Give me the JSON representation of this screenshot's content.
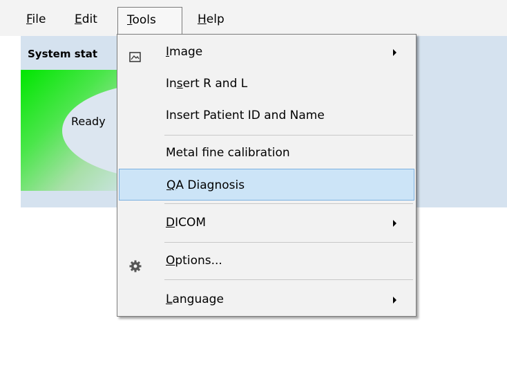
{
  "menubar": {
    "file": {
      "hot": "F",
      "rest": "ile"
    },
    "edit": {
      "hot": "E",
      "rest": "dit"
    },
    "tools": {
      "hot": "T",
      "rest": "ools"
    },
    "help": {
      "hot": "H",
      "rest": "elp"
    }
  },
  "panel": {
    "header": "System stat",
    "status": "Ready"
  },
  "tools_menu": {
    "image": {
      "hot": "I",
      "rest": "mage",
      "icon": "image-icon",
      "submenu": true
    },
    "insert_rl": {
      "pre": "In",
      "hot": "s",
      "rest": "ert R and L"
    },
    "insert_patient": {
      "label": "Insert Patient ID and Name"
    },
    "metal": {
      "label": "Metal fine calibration"
    },
    "qa": {
      "hot": "Q",
      "rest": "A Diagnosis"
    },
    "dicom": {
      "hot": "D",
      "rest": "ICOM",
      "submenu": true
    },
    "options": {
      "hot": "O",
      "rest": "ptions...",
      "icon": "gear-icon"
    },
    "language": {
      "hot": "L",
      "rest": "anguage",
      "submenu": true
    }
  }
}
